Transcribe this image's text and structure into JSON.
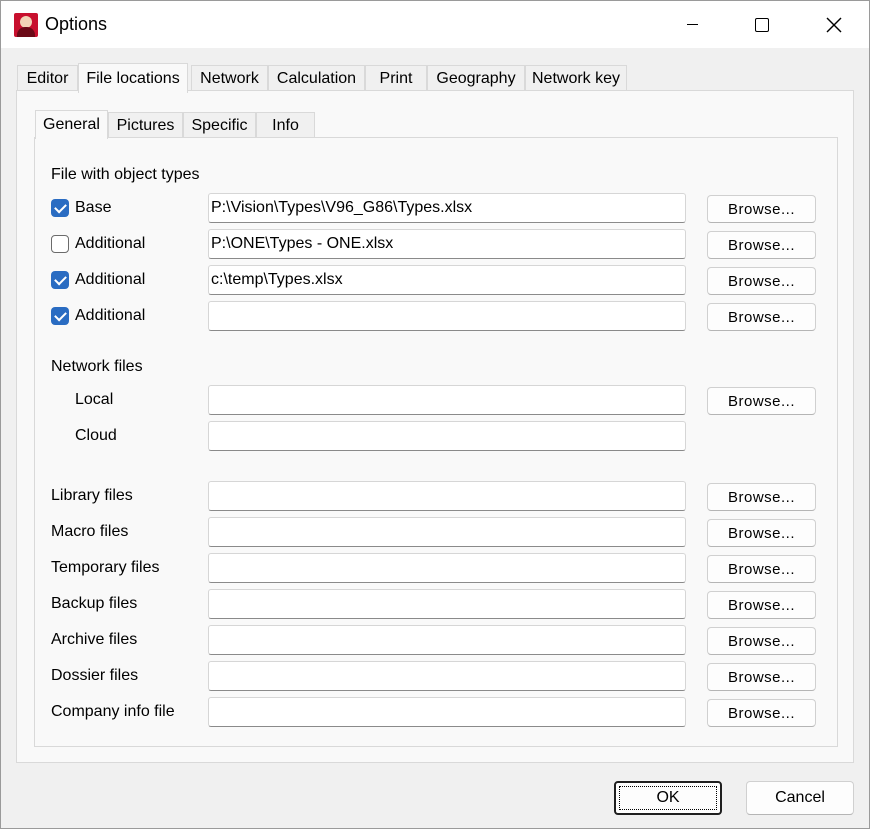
{
  "window": {
    "title": "Options"
  },
  "outer_tabs": [
    "Editor",
    "File locations",
    "Network",
    "Calculation",
    "Print",
    "Geography",
    "Network key"
  ],
  "inner_tabs": [
    "General",
    "Pictures",
    "Specific",
    "Info"
  ],
  "object_types": {
    "heading": "File with object types",
    "rows": [
      {
        "label": "Base",
        "checked": true,
        "value": "P:\\Vision\\Types\\V96_G86\\Types.xlsx"
      },
      {
        "label": "Additional",
        "checked": false,
        "value": "P:\\ONE\\Types - ONE.xlsx"
      },
      {
        "label": "Additional",
        "checked": true,
        "value": "c:\\temp\\Types.xlsx"
      },
      {
        "label": "Additional",
        "checked": true,
        "value": ""
      }
    ]
  },
  "network_files": {
    "heading": "Network files",
    "local_label": "Local",
    "local_value": "",
    "cloud_label": "Cloud",
    "cloud_value": ""
  },
  "other_files": [
    {
      "label": "Library files",
      "value": ""
    },
    {
      "label": "Macro files",
      "value": ""
    },
    {
      "label": "Temporary files",
      "value": ""
    },
    {
      "label": "Backup files",
      "value": ""
    },
    {
      "label": "Archive files",
      "value": ""
    },
    {
      "label": "Dossier files",
      "value": ""
    },
    {
      "label": "Company info file",
      "value": ""
    }
  ],
  "browse_label": "Browse...",
  "buttons": {
    "ok": "OK",
    "cancel": "Cancel"
  },
  "colors": {
    "checkbox_checked": "#2a6cc2",
    "window_bg": "#f0f0f0",
    "panel_bg": "#f9f9f9"
  }
}
